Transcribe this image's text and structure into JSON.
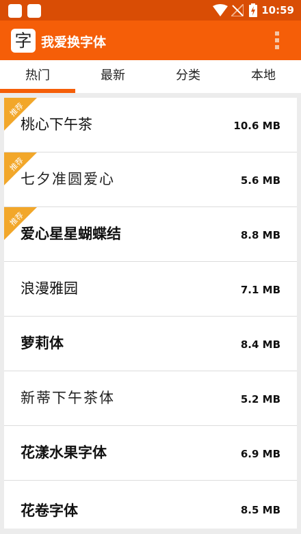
{
  "status_bar": {
    "time": "10:59",
    "icons": [
      "notification-square-icon",
      "notification-square-icon",
      "wifi-icon",
      "no-signal-icon",
      "battery-charging-icon"
    ]
  },
  "app_bar": {
    "logo_char": "字",
    "title": "我爱换字体",
    "menu_icon": "overflow-menu-icon"
  },
  "tabs": [
    {
      "label": "热门",
      "selected": true
    },
    {
      "label": "最新",
      "selected": false
    },
    {
      "label": "分类",
      "selected": false
    },
    {
      "label": "本地",
      "selected": false
    }
  ],
  "colors": {
    "status_bar": "#d94d05",
    "app_bar": "#f55e08",
    "accent": "#f55e08",
    "badge": "#f2a72a"
  },
  "fonts": [
    {
      "name": "桃心下午茶",
      "size": "10.6 MB",
      "badge": "推荐"
    },
    {
      "name": "七夕准圆爱心",
      "size": "5.6 MB",
      "badge": "推荐"
    },
    {
      "name": "爱心星星蝴蝶结",
      "size": "8.8 MB",
      "badge": "推荐"
    },
    {
      "name": "浪漫雅园",
      "size": "7.1 MB"
    },
    {
      "name": "萝莉体",
      "size": "8.4 MB"
    },
    {
      "name": "新蒂下午茶体",
      "size": "5.2 MB"
    },
    {
      "name": "花漾水果字体",
      "size": "6.9 MB"
    },
    {
      "name": "花卷字体",
      "size": "8.5 MB"
    }
  ]
}
